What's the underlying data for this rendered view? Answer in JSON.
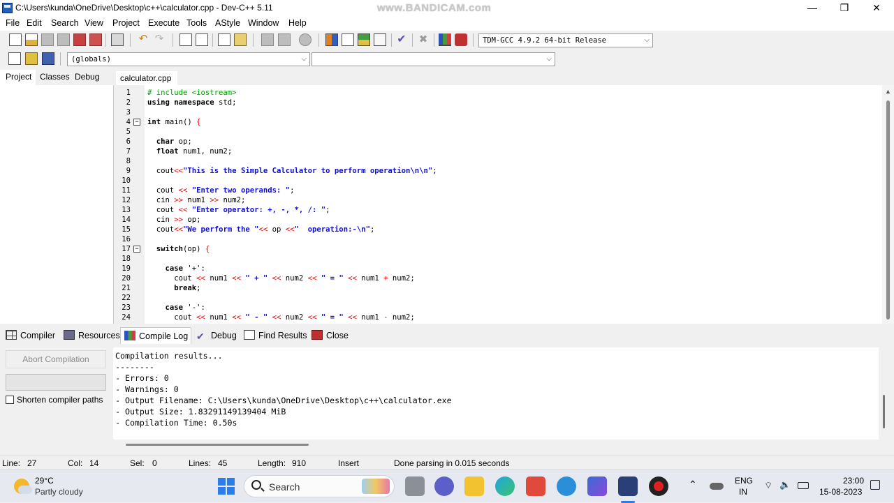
{
  "window": {
    "title": "C:\\Users\\kunda\\OneDrive\\Desktop\\c++\\calculator.cpp - Dev-C++ 5.11",
    "watermark": "www.BANDICAM.com",
    "minimize": "—",
    "restore": "❐",
    "close": "✕"
  },
  "menu": [
    "File",
    "Edit",
    "Search",
    "View",
    "Project",
    "Execute",
    "Tools",
    "AStyle",
    "Window",
    "Help"
  ],
  "toolbar": {
    "compiler_select": "TDM-GCC 4.9.2 64-bit Release",
    "scope_select": "(globals)",
    "function_select": ""
  },
  "left_tabs": [
    "Project",
    "Classes",
    "Debug"
  ],
  "editor": {
    "tab_label": "calculator.cpp",
    "lines": [
      {
        "n": "1",
        "fold": "",
        "parts": [
          [
            "pp",
            "# include <iostream>"
          ]
        ]
      },
      {
        "n": "2",
        "fold": "",
        "parts": [
          [
            "kw",
            "using namespace"
          ],
          [
            "txt",
            " std;"
          ]
        ]
      },
      {
        "n": "3",
        "fold": "",
        "parts": []
      },
      {
        "n": "4",
        "fold": "−",
        "parts": [
          [
            "kw",
            "int"
          ],
          [
            "txt",
            " main() "
          ],
          [
            "op",
            "{"
          ]
        ]
      },
      {
        "n": "5",
        "fold": "",
        "parts": []
      },
      {
        "n": "6",
        "fold": "",
        "parts": [
          [
            "txt",
            "  "
          ],
          [
            "kw",
            "char"
          ],
          [
            "txt",
            " op;"
          ]
        ]
      },
      {
        "n": "7",
        "fold": "",
        "parts": [
          [
            "txt",
            "  "
          ],
          [
            "kw",
            "float"
          ],
          [
            "txt",
            " num1, num2;"
          ]
        ]
      },
      {
        "n": "8",
        "fold": "",
        "parts": []
      },
      {
        "n": "9",
        "fold": "",
        "parts": [
          [
            "txt",
            "  cout"
          ],
          [
            "op",
            "<<"
          ],
          [
            "str",
            "\"This is the Simple Calculator to perform operation\\n\\n\""
          ],
          [
            "txt",
            ";"
          ]
        ]
      },
      {
        "n": "10",
        "fold": "",
        "parts": []
      },
      {
        "n": "11",
        "fold": "",
        "parts": [
          [
            "txt",
            "  cout "
          ],
          [
            "op",
            "<<"
          ],
          [
            "str",
            " \"Enter two operands: \""
          ],
          [
            "txt",
            ";"
          ]
        ]
      },
      {
        "n": "12",
        "fold": "",
        "parts": [
          [
            "txt",
            "  cin "
          ],
          [
            "op",
            ">>"
          ],
          [
            "txt",
            " num1 "
          ],
          [
            "op",
            ">>"
          ],
          [
            "txt",
            " num2;"
          ]
        ]
      },
      {
        "n": "13",
        "fold": "",
        "parts": [
          [
            "txt",
            "  cout "
          ],
          [
            "op",
            "<<"
          ],
          [
            "str",
            " \"Enter operator: +, -, *, /: \""
          ],
          [
            "txt",
            ";"
          ]
        ]
      },
      {
        "n": "14",
        "fold": "",
        "parts": [
          [
            "txt",
            "  cin "
          ],
          [
            "op",
            ">>"
          ],
          [
            "txt",
            " op;"
          ]
        ]
      },
      {
        "n": "15",
        "fold": "",
        "parts": [
          [
            "txt",
            "  cout"
          ],
          [
            "op",
            "<<"
          ],
          [
            "str",
            "\"We perform the \""
          ],
          [
            "op",
            "<<"
          ],
          [
            "txt",
            " op "
          ],
          [
            "op",
            "<<"
          ],
          [
            "str",
            "\"  operation:-\\n\""
          ],
          [
            "txt",
            ";"
          ]
        ]
      },
      {
        "n": "16",
        "fold": "",
        "parts": []
      },
      {
        "n": "17",
        "fold": "−",
        "parts": [
          [
            "txt",
            "  "
          ],
          [
            "kw",
            "switch"
          ],
          [
            "txt",
            "(op) "
          ],
          [
            "op",
            "{"
          ]
        ]
      },
      {
        "n": "18",
        "fold": "",
        "parts": []
      },
      {
        "n": "19",
        "fold": "",
        "parts": [
          [
            "txt",
            "    "
          ],
          [
            "kw",
            "case"
          ],
          [
            "txt",
            " '+':"
          ]
        ]
      },
      {
        "n": "20",
        "fold": "",
        "parts": [
          [
            "txt",
            "      cout "
          ],
          [
            "op",
            "<<"
          ],
          [
            "txt",
            " num1 "
          ],
          [
            "op",
            "<<"
          ],
          [
            "str",
            " \" + \" "
          ],
          [
            "op",
            "<<"
          ],
          [
            "txt",
            " num2 "
          ],
          [
            "op",
            "<<"
          ],
          [
            "str",
            " \" = \" "
          ],
          [
            "op",
            "<<"
          ],
          [
            "txt",
            " num1 "
          ],
          [
            "op",
            "+"
          ],
          [
            "txt",
            " num2;"
          ]
        ]
      },
      {
        "n": "21",
        "fold": "",
        "parts": [
          [
            "txt",
            "      "
          ],
          [
            "kw",
            "break"
          ],
          [
            "txt",
            ";"
          ]
        ]
      },
      {
        "n": "22",
        "fold": "",
        "parts": []
      },
      {
        "n": "23",
        "fold": "",
        "parts": [
          [
            "txt",
            "    "
          ],
          [
            "kw",
            "case"
          ],
          [
            "txt",
            " '-':"
          ]
        ]
      },
      {
        "n": "24",
        "fold": "",
        "parts": [
          [
            "txt",
            "      cout "
          ],
          [
            "op",
            "<<"
          ],
          [
            "txt",
            " num1 "
          ],
          [
            "op",
            "<<"
          ],
          [
            "str",
            " \" - \" "
          ],
          [
            "op",
            "<<"
          ],
          [
            "txt",
            " num2 "
          ],
          [
            "op",
            "<<"
          ],
          [
            "str",
            " \" = \" "
          ],
          [
            "op",
            "<<"
          ],
          [
            "txt",
            " num1 "
          ],
          [
            "op",
            "-"
          ],
          [
            "txt",
            " num2;"
          ]
        ]
      }
    ]
  },
  "bottom_tabs": [
    "Compiler",
    "Resources",
    "Compile Log",
    "Debug",
    "Find Results",
    "Close"
  ],
  "compile_panel": {
    "abort_label": "Abort Compilation",
    "shorten_label": "Shorten compiler paths",
    "log_lines": [
      "Compilation results...",
      "--------",
      "- Errors: 0",
      "- Warnings: 0",
      "- Output Filename: C:\\Users\\kunda\\OneDrive\\Desktop\\c++\\calculator.exe",
      "- Output Size: 1.83291149139404 MiB",
      "- Compilation Time: 0.50s"
    ]
  },
  "status": {
    "line_label": "Line:",
    "line_value": "27",
    "col_label": "Col:",
    "col_value": "14",
    "sel_label": "Sel:",
    "sel_value": "0",
    "lines_label": "Lines:",
    "lines_value": "45",
    "length_label": "Length:",
    "length_value": "910",
    "mode": "Insert",
    "message": "Done parsing in 0.015 seconds"
  },
  "taskbar": {
    "weather_temp": "29°C",
    "weather_desc": "Partly cloudy",
    "search_label": "Search",
    "lang_top": "ENG",
    "lang_bottom": "IN",
    "time": "23:00",
    "date": "15-08-2023"
  }
}
